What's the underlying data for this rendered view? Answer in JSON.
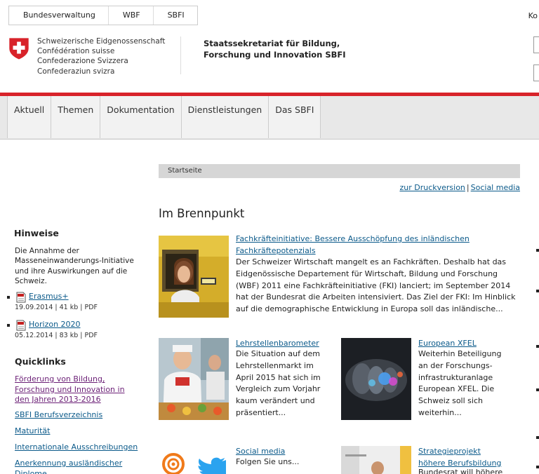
{
  "breadcrumb": [
    "Bundesverwaltung",
    "WBF",
    "SBFI"
  ],
  "top_right_text": "Ko",
  "confederation": [
    "Schweizerische Eidgenossenschaft",
    "Confédération suisse",
    "Confederazione Svizzera",
    "Confederaziun svizra"
  ],
  "office": [
    "Staatssekretariat für Bildung,",
    "Forschung und Innovation SBFI"
  ],
  "nav": [
    "Aktuell",
    "Themen",
    "Dokumentation",
    "Dienstleistungen",
    "Das SBFI"
  ],
  "crumb": "Startseite",
  "util": {
    "print": "zur Druckversion",
    "social": "Social media"
  },
  "heading": "Im Brennpunkt",
  "teasers": [
    {
      "title_lines": [
        "Fachkräfteinitiative: Bessere Ausschöpfung des inländischen",
        "Fachkräftepotenzials"
      ],
      "body_lines": [
        "Der Schweizer Wirtschaft mangelt es an Fachkräften. Deshalb hat das",
        "Eidgenössische Departement für Wirtschaft, Bildung und Forschung",
        "(WBF) 2011 eine Fachkräfteinitiative (FKI) lanciert; im September 2014",
        "hat der Bundesrat die Arbeiten intensiviert. Das Ziel der FKI: Im Hinblick",
        "auf die demographische Entwicklung in Europa soll das inländische..."
      ]
    },
    {
      "title_lines": [
        "Lehrstellenbarometer"
      ],
      "body_lines": [
        "Die Situation auf dem",
        "Lehrstellenmarkt im",
        "April 2015 hat sich im",
        "Vergleich zum Vorjahr",
        "kaum verändert und",
        "präsentiert..."
      ]
    },
    {
      "title_lines": [
        "European XFEL"
      ],
      "body_lines": [
        "Weiterhin Beteiligung",
        "an der Forschungs-",
        "infrastrukturanlage",
        "European XFEL. Die",
        "Schweiz soll sich",
        "weiterhin..."
      ]
    },
    {
      "title_lines": [
        "Social media"
      ],
      "body_lines": [
        "Folgen Sie uns..."
      ]
    },
    {
      "title_lines": [
        "Strategieprojekt",
        "höhere Berufsbildung"
      ],
      "body_lines": [
        "Bundesrat will höhere"
      ]
    }
  ],
  "sidebar": {
    "hinweise_title": "Hinweise",
    "hinweise_text": "Die Annahme der Masseneinwanderungs-Initiative und ihre Auswirkungen auf die Schweiz.",
    "downloads": [
      {
        "label": "Erasmus+",
        "meta": "19.09.2014 | 41 kb | PDF"
      },
      {
        "label": "Horizon 2020",
        "meta": "05.12.2014 | 83 kb | PDF"
      }
    ],
    "quicklinks_title": "Quicklinks",
    "quicklinks": [
      "Förderung von Bildung, Forschung und Innovation in den Jahren 2013-2016",
      "SBFI Berufsverzeichnis",
      "Maturität",
      "Internationale Ausschreibungen",
      "Anerkennung ausländischer Diplome"
    ]
  },
  "colors": {
    "accent_red": "#d8232a",
    "link": "#0b5a8a",
    "visited": "#6b1f76"
  }
}
